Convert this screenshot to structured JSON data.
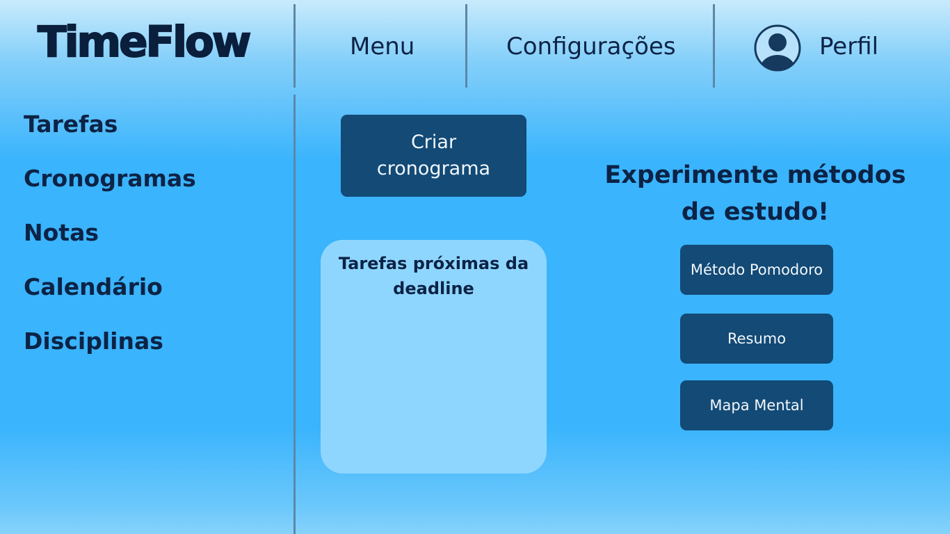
{
  "header": {
    "logo": "TimeFlow",
    "nav": {
      "menu": "Menu",
      "settings": "Configurações",
      "profile": "Perfil"
    }
  },
  "sidebar": {
    "items": [
      {
        "label": "Tarefas"
      },
      {
        "label": "Cronogramas"
      },
      {
        "label": "Notas"
      },
      {
        "label": "Calendário"
      },
      {
        "label": "Disciplinas"
      }
    ]
  },
  "main": {
    "create_schedule_label": "Criar cronograma",
    "deadline_card": {
      "title": "Tarefas próximas da deadline"
    }
  },
  "study_methods": {
    "heading": "Experimente métodos de estudo!",
    "buttons": [
      {
        "label": "Método Pomodoro"
      },
      {
        "label": "Resumo"
      },
      {
        "label": "Mapa Mental"
      }
    ]
  },
  "icons": {
    "avatar": "user-avatar-icon"
  },
  "colors": {
    "primary_button": "#134a76",
    "text_dark": "#0c2346",
    "card_bg": "#8fd6fe",
    "background": "#3ab4fc"
  }
}
